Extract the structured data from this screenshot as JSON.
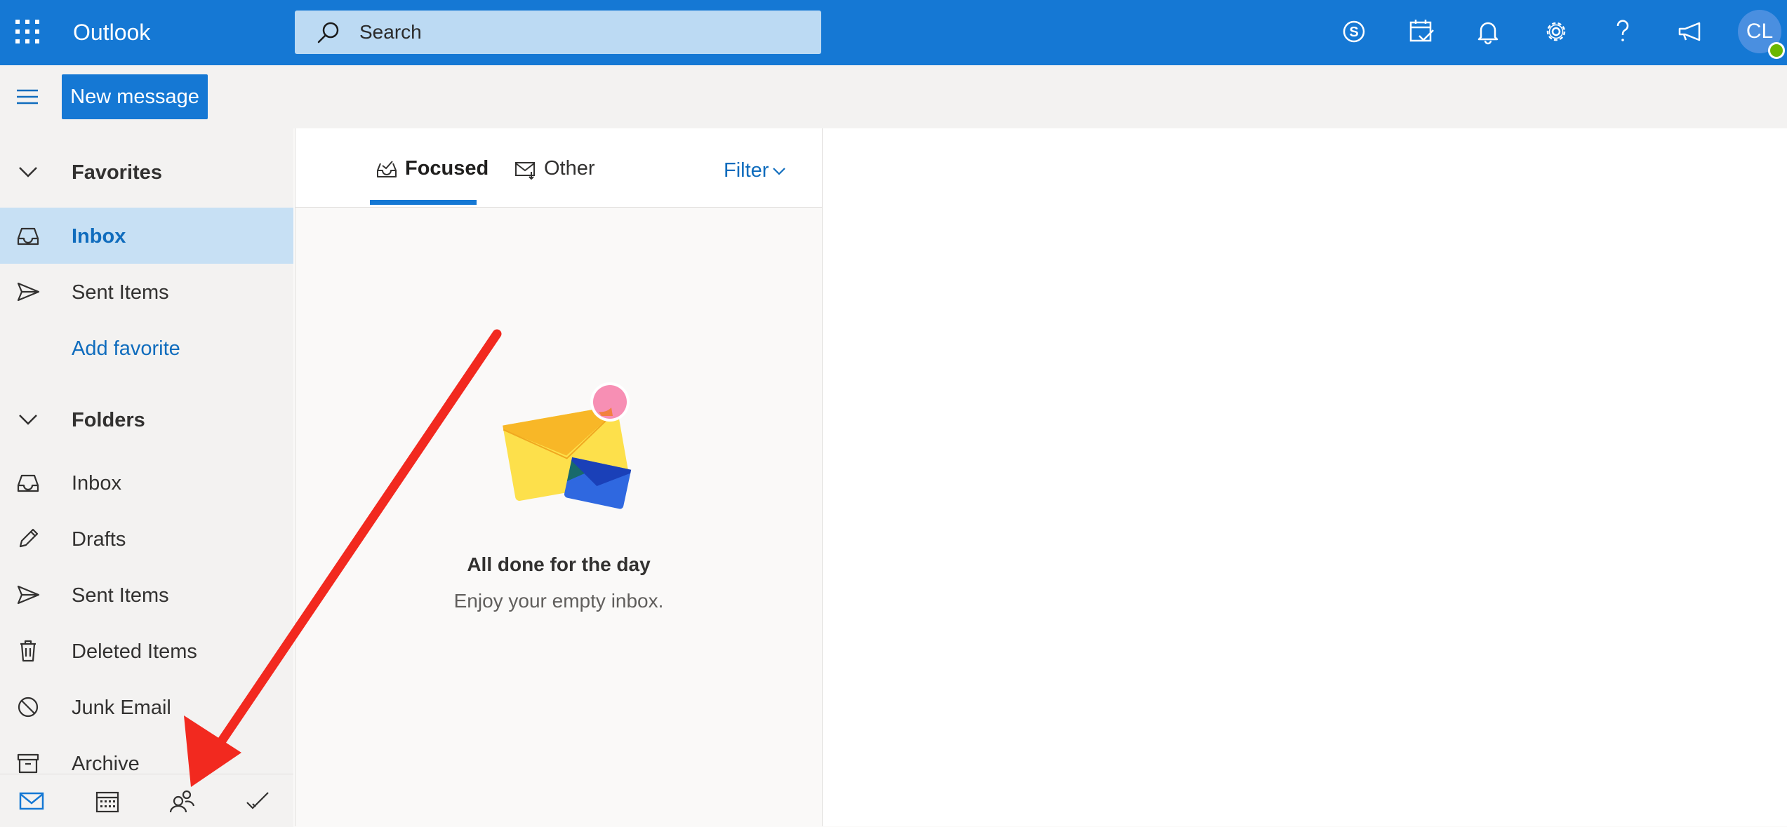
{
  "header": {
    "app_name": "Outlook",
    "search_placeholder": "Search",
    "avatar_initials": "CL",
    "icons": [
      "skype-icon",
      "my-day-icon",
      "bell-icon",
      "gear-icon",
      "help-icon",
      "feedback-megaphone-icon"
    ]
  },
  "commandbar": {
    "new_message_label": "New message"
  },
  "sidebar": {
    "favorites_header": "Favorites",
    "favorites": [
      {
        "label": "Inbox",
        "icon": "inbox-icon",
        "selected": true
      },
      {
        "label": "Sent Items",
        "icon": "send-icon"
      }
    ],
    "add_favorite_label": "Add favorite",
    "folders_header": "Folders",
    "folders": [
      {
        "label": "Inbox",
        "icon": "inbox-icon"
      },
      {
        "label": "Drafts",
        "icon": "pencil-icon"
      },
      {
        "label": "Sent Items",
        "icon": "send-icon"
      },
      {
        "label": "Deleted Items",
        "icon": "trash-icon"
      },
      {
        "label": "Junk Email",
        "icon": "block-icon"
      },
      {
        "label": "Archive",
        "icon": "archive-icon"
      }
    ],
    "bottom_nav": [
      "mail-icon",
      "calendar-icon",
      "people-icon",
      "todo-check-icon"
    ]
  },
  "message_list": {
    "tabs": [
      {
        "label": "Focused",
        "selected": true
      },
      {
        "label": "Other",
        "selected": false
      }
    ],
    "filter_label": "Filter",
    "empty_title": "All done for the day",
    "empty_subtitle": "Enjoy your empty inbox."
  },
  "colors": {
    "brand_blue": "#1578d4",
    "selected_bg": "#c7e0f4",
    "annotation_arrow": "#f2291f"
  }
}
